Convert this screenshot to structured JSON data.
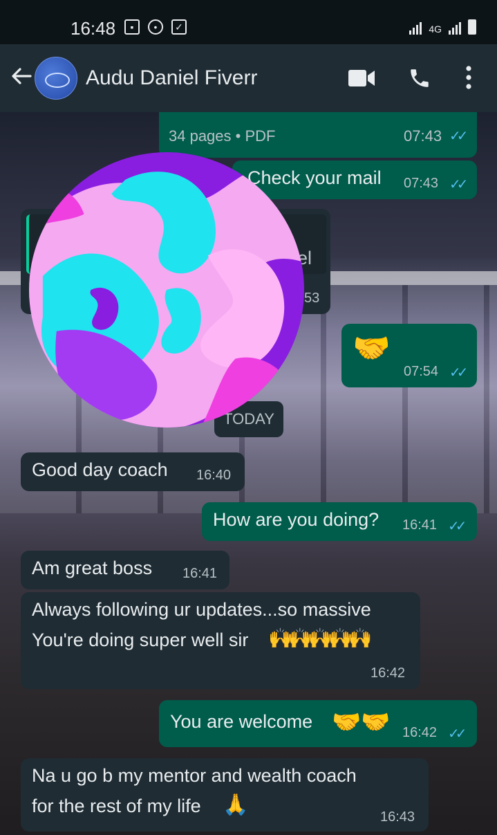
{
  "status_bar": {
    "time": "16:48",
    "network": "4G"
  },
  "header": {
    "contact_name": "Audu Daniel Fiverr"
  },
  "messages": {
    "pdf": {
      "info": "34 pages • PDF",
      "time": "07:43"
    },
    "check_mail": {
      "text": "Check your mail",
      "time": "07:43"
    },
    "partial_in": {
      "frag1": "el",
      "frag2": "53"
    },
    "handshake": {
      "emoji": "🤝",
      "time": "07:54"
    },
    "date_chip": "TODAY",
    "m1": {
      "text": "Good day coach",
      "time": "16:40"
    },
    "m2": {
      "text": "How are you doing?",
      "time": "16:41"
    },
    "m3": {
      "text": "Am great boss",
      "time": "16:41"
    },
    "m4": {
      "line1": "Always following ur updates...so massive",
      "line2": "You're doing super well sir",
      "emoji": "🙌🙌🙌🙌🙌",
      "time": "16:42"
    },
    "m5": {
      "text": "You are welcome",
      "emoji": "🤝🤝",
      "time": "16:42"
    },
    "m6": {
      "line1": "Na u go b my mentor and wealth coach",
      "line2": "for the rest of my life",
      "emoji": "🙏",
      "time": "16:43"
    }
  },
  "colors": {
    "incoming_bubble": "#1f2c34",
    "outgoing_bubble": "#005c4b",
    "read_ticks": "#53bdeb",
    "header": "#1f2c34"
  }
}
